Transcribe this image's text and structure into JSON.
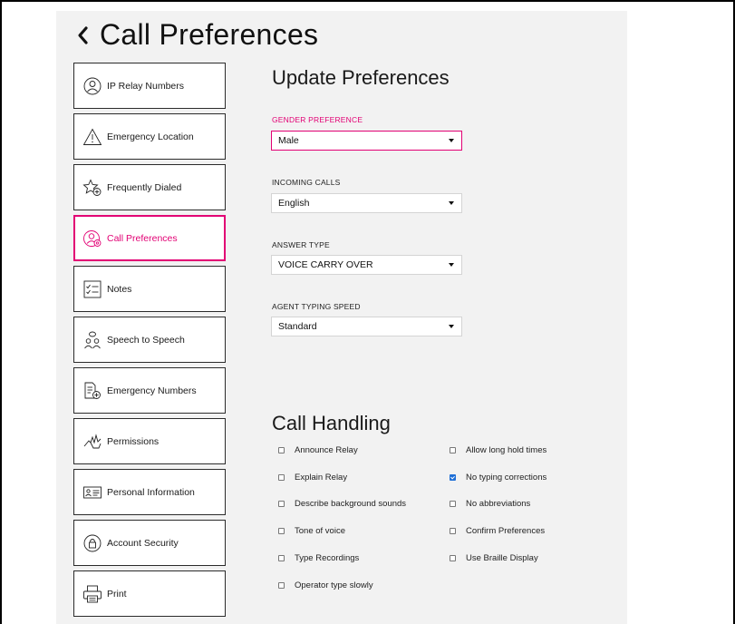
{
  "header": {
    "title": "Call Preferences"
  },
  "sidebar": {
    "items": [
      {
        "label": "IP Relay Numbers",
        "icon": "person-circle-icon",
        "active": false
      },
      {
        "label": "Emergency Location",
        "icon": "warning-triangle-icon",
        "active": false
      },
      {
        "label": "Frequently Dialed",
        "icon": "star-plus-icon",
        "active": false
      },
      {
        "label": "Call Preferences",
        "icon": "person-settings-icon",
        "active": true
      },
      {
        "label": "Notes",
        "icon": "checklist-icon",
        "active": false
      },
      {
        "label": "Speech to Speech",
        "icon": "people-speech-icon",
        "active": false
      },
      {
        "label": "Emergency Numbers",
        "icon": "document-plus-icon",
        "active": false
      },
      {
        "label": "Permissions",
        "icon": "hand-permissions-icon",
        "active": false
      },
      {
        "label": "Personal Information",
        "icon": "id-card-icon",
        "active": false
      },
      {
        "label": "Account Security",
        "icon": "lock-circle-icon",
        "active": false
      },
      {
        "label": "Print",
        "icon": "printer-icon",
        "active": false
      }
    ]
  },
  "preferences": {
    "title": "Update Preferences",
    "fields": [
      {
        "label": "GENDER PREFERENCE",
        "value": "Male",
        "focused": true
      },
      {
        "label": "INCOMING CALLS",
        "value": "English",
        "focused": false
      },
      {
        "label": "ANSWER TYPE",
        "value": "VOICE CARRY OVER",
        "focused": false
      },
      {
        "label": "AGENT TYPING SPEED",
        "value": "Standard",
        "focused": false
      }
    ]
  },
  "call_handling": {
    "title": "Call Handling",
    "left": [
      {
        "label": "Announce Relay",
        "checked": false
      },
      {
        "label": "Explain Relay",
        "checked": false
      },
      {
        "label": "Describe background sounds",
        "checked": false
      },
      {
        "label": "Tone of voice",
        "checked": false
      },
      {
        "label": "Type Recordings",
        "checked": false
      },
      {
        "label": "Operator type slowly",
        "checked": false
      }
    ],
    "right": [
      {
        "label": "Allow long hold times",
        "checked": false
      },
      {
        "label": "No typing corrections",
        "checked": true
      },
      {
        "label": "No abbreviations",
        "checked": false
      },
      {
        "label": "Confirm Preferences",
        "checked": false
      },
      {
        "label": "Use Braille Display",
        "checked": false
      }
    ]
  },
  "colors": {
    "accent": "#e20074",
    "panel": "#f2f2f2",
    "checkbox_checked": "#1f6fd6"
  }
}
